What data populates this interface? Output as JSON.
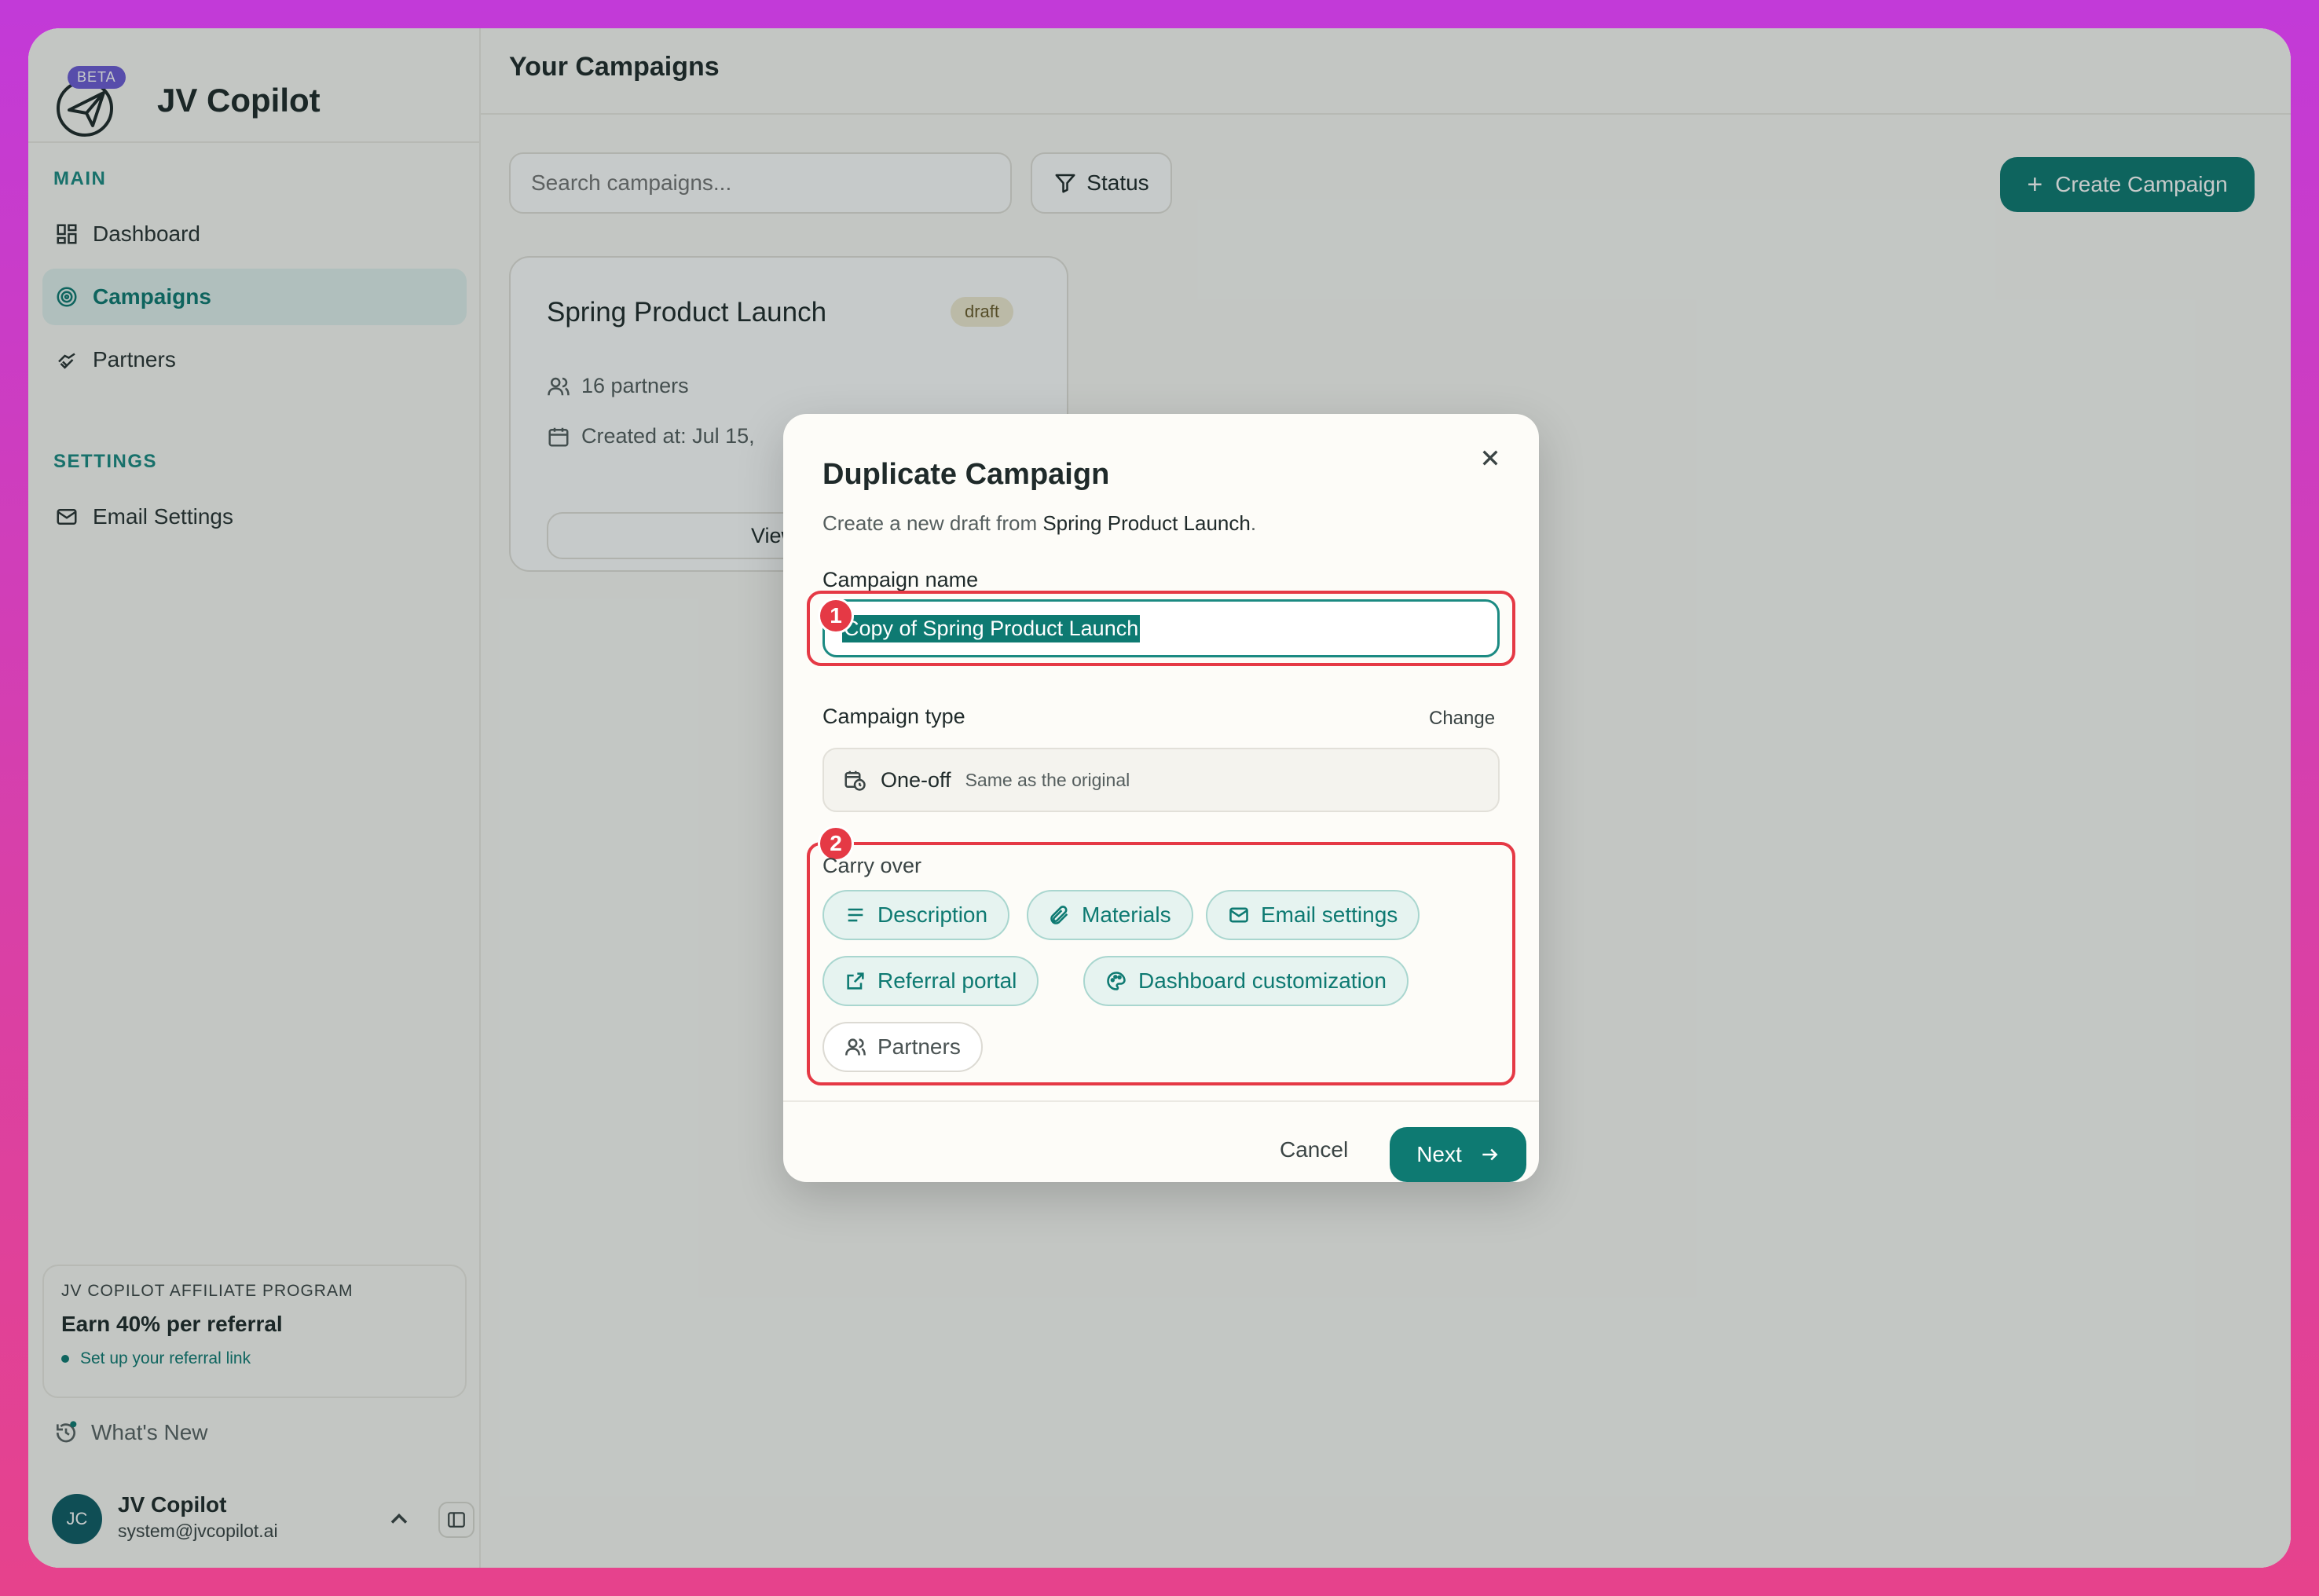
{
  "brand": {
    "name": "JV Copilot",
    "badge": "BETA"
  },
  "sidebar": {
    "main_label": "MAIN",
    "settings_label": "SETTINGS",
    "items": [
      {
        "label": "Dashboard",
        "icon": "grid-icon"
      },
      {
        "label": "Campaigns",
        "icon": "target-icon",
        "active": true
      },
      {
        "label": "Partners",
        "icon": "handshake-icon"
      },
      {
        "label": "Email Settings",
        "icon": "mail-icon"
      }
    ],
    "affiliate": {
      "overline": "JV COPILOT AFFILIATE PROGRAM",
      "title": "Earn 40% per referral",
      "link": "Set up your referral link"
    },
    "whats_new": "What's New",
    "user": {
      "initials": "JC",
      "name": "JV Copilot",
      "email": "system@jvcopilot.ai"
    }
  },
  "main": {
    "title": "Your Campaigns",
    "search_placeholder": "Search campaigns...",
    "status_label": "Status",
    "create_label": "Create Campaign",
    "card": {
      "title": "Spring Product Launch",
      "badge": "draft",
      "partners": "16 partners",
      "created": "Created at: Jul 15,",
      "button": "View De"
    }
  },
  "dialog": {
    "title": "Duplicate Campaign",
    "subtitle_prefix": "Create a new draft from ",
    "subtitle_source": "Spring Product Launch",
    "subtitle_suffix": ".",
    "name_label": "Campaign name",
    "name_value": "Copy of Spring Product Launch",
    "type_label": "Campaign type",
    "change_label": "Change",
    "type_value": "One-off",
    "type_note": "Same as the original",
    "carry_label": "Carry over",
    "chips": [
      {
        "label": "Description",
        "selected": true
      },
      {
        "label": "Materials",
        "selected": true
      },
      {
        "label": "Email settings",
        "selected": true
      },
      {
        "label": "Referral portal",
        "selected": true
      },
      {
        "label": "Dashboard customization",
        "selected": true
      },
      {
        "label": "Partners",
        "selected": false
      }
    ],
    "cancel_label": "Cancel",
    "next_label": "Next",
    "markers": [
      "1",
      "2"
    ]
  },
  "colors": {
    "accent": "#0e7a72",
    "highlight": "#e53945",
    "beta": "#6d5bd6"
  }
}
